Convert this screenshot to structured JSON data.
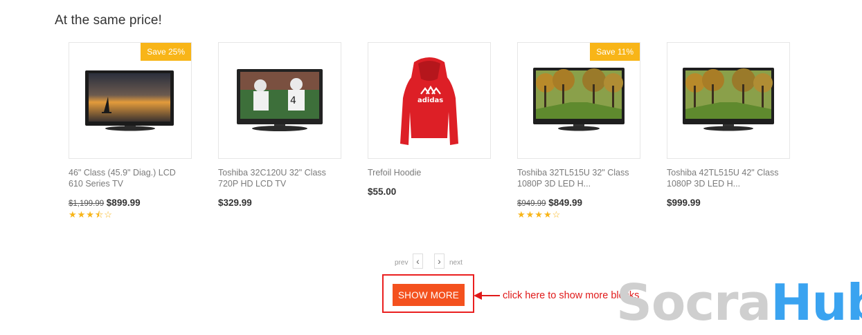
{
  "section": {
    "title": "At the same price!"
  },
  "products": [
    {
      "name": "46\" Class (45.9\" Diag.) LCD 610 Series TV",
      "badge": "Save 25%",
      "old_price": "$1,199.99",
      "price": "$899.99",
      "rating": 3.5,
      "stars": "★★★⯪☆",
      "image": "tv-sunset"
    },
    {
      "name": "Toshiba 32C120U 32\" Class 720P HD LCD TV",
      "badge": "",
      "old_price": "",
      "price": "$329.99",
      "rating": null,
      "stars": "",
      "image": "tv-football"
    },
    {
      "name": "Trefoil Hoodie",
      "badge": "",
      "old_price": "",
      "price": "$55.00",
      "rating": null,
      "stars": "",
      "image": "red-hoodie"
    },
    {
      "name": "Toshiba 32TL515U 32\" Class 1080P 3D LED H...",
      "badge": "Save 11%",
      "old_price": "$949.99",
      "price": "$849.99",
      "rating": 4,
      "stars": "★★★★☆",
      "image": "tv-trees"
    },
    {
      "name": "Toshiba 42TL515U 42\" Class 1080P 3D LED H...",
      "badge": "",
      "old_price": "",
      "price": "$999.99",
      "rating": null,
      "stars": "",
      "image": "tv-trees"
    }
  ],
  "pager": {
    "prev_label": "prev",
    "next_label": "next",
    "prev_icon": "chevron-left-icon",
    "next_icon": "chevron-right-icon"
  },
  "show_more": {
    "label": "SHOW MORE"
  },
  "annotation": {
    "text": "click here to show more blocks"
  },
  "watermark": {
    "part1": "Socra",
    "part2": "Hub"
  },
  "colors": {
    "badge": "#f8b518",
    "button": "#f4511e",
    "annotation": "#e01919",
    "watermark_blue": "#3aa3f0"
  }
}
